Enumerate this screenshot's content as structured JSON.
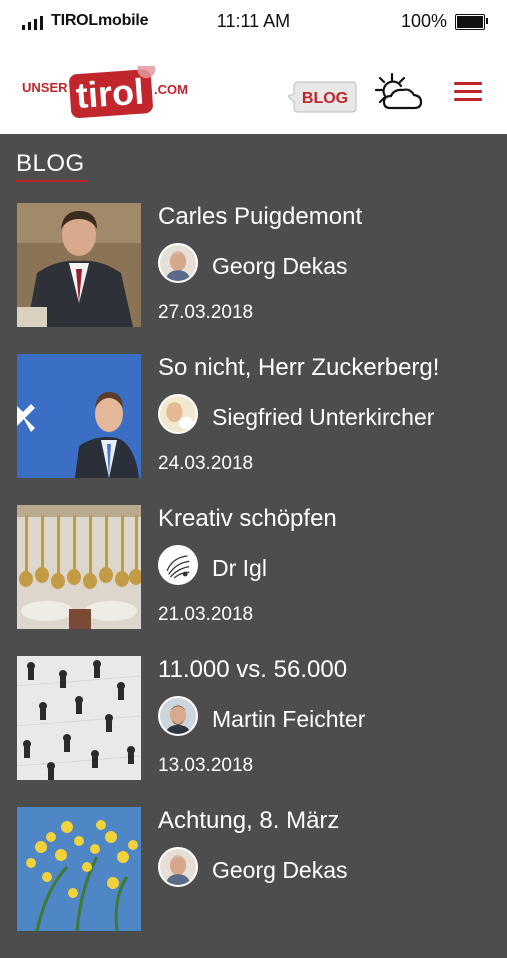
{
  "status": {
    "carrier": "TIROLmobile",
    "time": "11:11 AM",
    "battery": "100%",
    "battery_level": 1.0
  },
  "header": {
    "logo": {
      "pre": "UNSER",
      "main": "tirol",
      "post": ".COM"
    },
    "blog_button": "BLOG",
    "icons": {
      "weather": "partly-cloudy-icon",
      "menu": "hamburger-menu-icon"
    },
    "brand_color": "#c0262c"
  },
  "section": {
    "title": "BLOG"
  },
  "posts": [
    {
      "title": "Carles Puigdemont",
      "author": "Georg Dekas",
      "date": "27.03.2018"
    },
    {
      "title": "So nicht, Herr Zuckerberg!",
      "author": "Siegfried Unterkircher",
      "date": "24.03.2018"
    },
    {
      "title": "Kreativ schöpfen",
      "author": "Dr Igl",
      "date": "21.03.2018"
    },
    {
      "title": "11.000 vs. 56.000",
      "author": "Martin Feichter",
      "date": "13.03.2018"
    },
    {
      "title": "Achtung, 8. März",
      "author": "Georg Dekas",
      "date": ""
    }
  ]
}
